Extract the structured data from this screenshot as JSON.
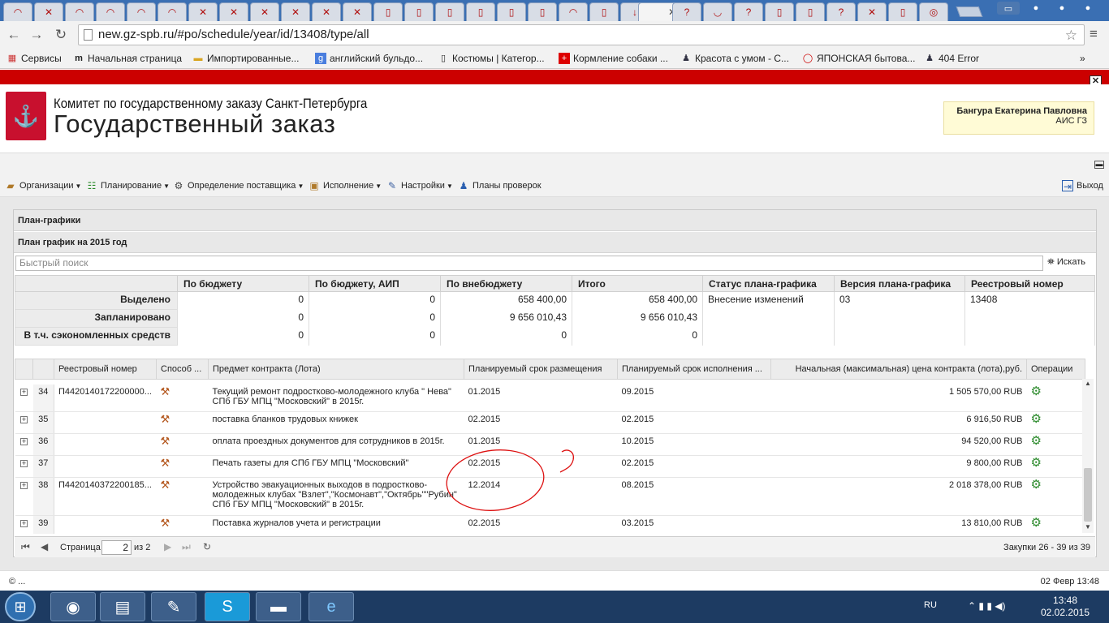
{
  "browser": {
    "url": "new.gz-spb.ru/#po/schedule/year/id/13408/type/all",
    "bookmarks": [
      {
        "label": "Сервисы",
        "icon": "apps-icon"
      },
      {
        "label": "Начальная страница",
        "icon": "m-icon"
      },
      {
        "label": "Импортированные...",
        "icon": "folder-icon"
      },
      {
        "label": "английский бульдо...",
        "icon": "g-icon"
      },
      {
        "label": "Костюмы | Категор...",
        "icon": "page-icon"
      },
      {
        "label": "Кормление собаки ...",
        "icon": "red-cross-icon"
      },
      {
        "label": "Красота с умом - С...",
        "icon": "person-icon"
      },
      {
        "label": "ЯПОНСКАЯ бытова...",
        "icon": "circle-icon"
      },
      {
        "label": "404 Error",
        "icon": "person-icon"
      }
    ],
    "bookmarks_more": "»"
  },
  "header": {
    "org_name": "Комитет по государственному заказу Санкт-Петербурга",
    "site_name": "Государственный заказ",
    "user_name": "Бангура Екатерина Павловна",
    "user_system": "АИС ГЗ"
  },
  "menu": {
    "items": [
      {
        "label": "Организации",
        "icon": "briefcase-icon"
      },
      {
        "label": "Планирование",
        "icon": "plan-icon"
      },
      {
        "label": "Определение поставщика",
        "icon": "gears-icon"
      },
      {
        "label": "Исполнение",
        "icon": "box-icon"
      },
      {
        "label": "Настройки",
        "icon": "wrench-icon"
      }
    ],
    "inspections": "Планы проверок",
    "logout": "Выход"
  },
  "panel": {
    "title": "План-графики",
    "subtitle": "План график на 2015 год",
    "search_placeholder": "Быстрый поиск",
    "search_button": "Искать"
  },
  "summary": {
    "columns": [
      "По бюджету",
      "По бюджету, АИП",
      "По внебюджету",
      "Итого",
      "Статус плана-графика",
      "Версия плана-графика",
      "Реестровый номер"
    ],
    "rows": [
      {
        "label": "Выделено",
        "budget": "0",
        "aip": "0",
        "extra": "658 400,00",
        "total": "658 400,00",
        "status": "Внесение изменений",
        "version": "03",
        "reg": "13408"
      },
      {
        "label": "Запланировано",
        "budget": "0",
        "aip": "0",
        "extra": "9 656 010,43",
        "total": "9 656 010,43",
        "status": "",
        "version": "",
        "reg": ""
      },
      {
        "label": "В т.ч. сэкономленных средств",
        "budget": "0",
        "aip": "0",
        "extra": "0",
        "total": "0",
        "status": "",
        "version": "",
        "reg": ""
      }
    ]
  },
  "grid": {
    "columns": [
      "Реестровый номер",
      "Способ ...",
      "Предмет контракта (Лота)",
      "Планируемый срок размещения",
      "Планируемый срок исполнения ...",
      "Начальная (максимальная) цена контракта (лота),руб.",
      "Операции"
    ],
    "rows": [
      {
        "n": "34",
        "reg": "П4420140172200000...",
        "subject": "Текущий ремонт подростково-молодежного клуба \" Нева\" СПб ГБУ МПЦ \"Московский\" в 2015г.",
        "placement": "01.2015",
        "execution": "09.2015",
        "price": "1 505 570,00 RUB"
      },
      {
        "n": "35",
        "reg": "",
        "subject": "поставка бланков трудовых книжек",
        "placement": "02.2015",
        "execution": "02.2015",
        "price": "6 916,50 RUB"
      },
      {
        "n": "36",
        "reg": "",
        "subject": "оплата проездных документов для сотрудников в 2015г.",
        "placement": "01.2015",
        "execution": "10.2015",
        "price": "94 520,00 RUB"
      },
      {
        "n": "37",
        "reg": "",
        "subject": "Печать газеты для СПб ГБУ МПЦ \"Московский\"",
        "placement": "02.2015",
        "execution": "02.2015",
        "price": "9 800,00 RUB"
      },
      {
        "n": "38",
        "reg": "П4420140372200185...",
        "subject": "Устройство эвакуационных выходов в подростково-молодежных клубах \"Взлет\",\"Космонавт\",\"Октябрь\"\"Рубин\" СПб ГБУ МПЦ \"Московский\" в 2015г.",
        "placement": "12.2014",
        "execution": "08.2015",
        "price": "2 018 378,00 RUB"
      },
      {
        "n": "39",
        "reg": "",
        "subject": "Поставка журналов учета и регистрации",
        "placement": "02.2015",
        "execution": "03.2015",
        "price": "13 810,00 RUB"
      }
    ]
  },
  "pager": {
    "page_label": "Страница",
    "page": "2",
    "of": "из 2",
    "info": "Закупки 26 - 39 из 39"
  },
  "footer": {
    "copyright": "© ...",
    "datetime": "02 Февр 13:48"
  },
  "taskbar": {
    "lang": "RU",
    "time": "13:48",
    "date": "02.02.2015"
  }
}
